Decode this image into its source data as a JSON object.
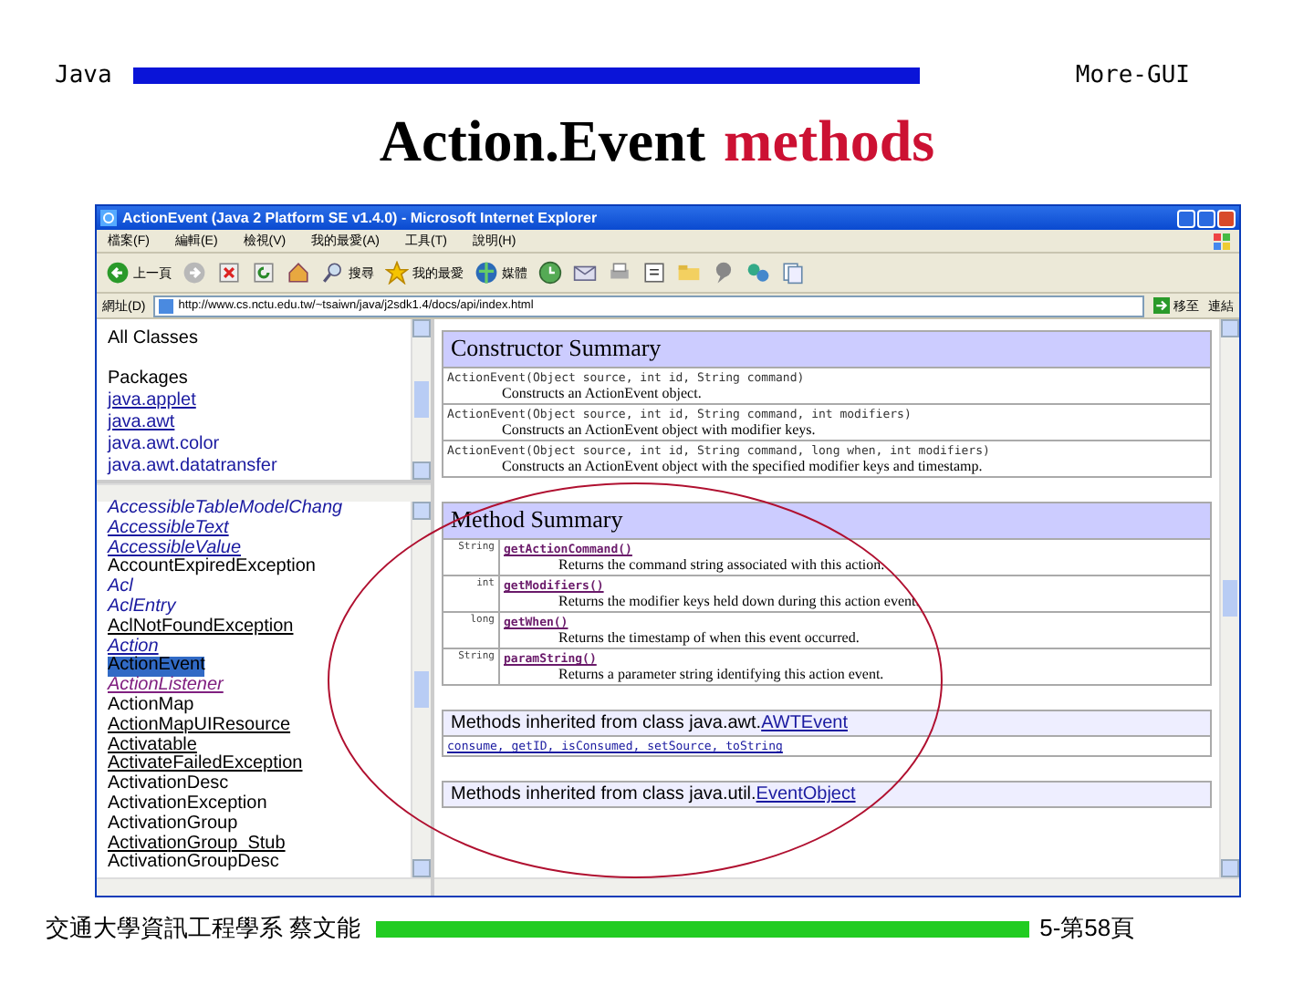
{
  "slide": {
    "header_left": "Java",
    "header_right": "More-GUI",
    "title_main": "Action.Event",
    "title_accent": "methods",
    "footer_left": "交通大學資訊工程學系 蔡文能",
    "footer_right": "5-第58頁"
  },
  "browser": {
    "title": "ActionEvent (Java 2 Platform SE v1.4.0) - Microsoft Internet Explorer",
    "menu": [
      "檔案(F)",
      "編輯(E)",
      "檢視(V)",
      "我的最愛(A)",
      "工具(T)",
      "說明(H)"
    ],
    "toolbar": [
      {
        "kind": "back",
        "label": "上一頁"
      },
      {
        "kind": "forward"
      },
      {
        "kind": "stop"
      },
      {
        "kind": "refresh"
      },
      {
        "kind": "home"
      },
      {
        "kind": "search",
        "label": "搜尋"
      },
      {
        "kind": "favorites",
        "label": "我的最愛"
      },
      {
        "kind": "media",
        "label": "媒體"
      },
      {
        "kind": "history"
      },
      {
        "kind": "mail"
      },
      {
        "kind": "print"
      },
      {
        "kind": "edit"
      },
      {
        "kind": "folder"
      },
      {
        "kind": "messenger"
      },
      {
        "kind": "network"
      },
      {
        "kind": "copy"
      }
    ],
    "address": {
      "label": "網址(D)",
      "value": "http://www.cs.nctu.edu.tw/~tsaiwn/java/j2sdk1.4/docs/api/index.html",
      "go_label": "移至",
      "links_label": "連結"
    },
    "all_classes": "All Classes",
    "packages_heading": "Packages",
    "packages": [
      {
        "text": "java.applet",
        "underlined": true
      },
      {
        "text": "java.awt",
        "underlined": true
      },
      {
        "text": "java.awt.color",
        "underlined": false
      },
      {
        "text": "java.awt.datatransfer",
        "underlined": false
      }
    ],
    "class_list": [
      {
        "text": "AccessibleTableModelChang",
        "kind": "interface",
        "underlined": false,
        "selected": false
      },
      {
        "text": "AccessibleText",
        "kind": "interface",
        "underlined": true,
        "selected": false
      },
      {
        "text": "AccessibleValue",
        "kind": "interface",
        "underlined": true,
        "selected": false
      },
      {
        "text": "AccountExpiredException",
        "kind": "class",
        "underlined": false,
        "selected": false
      },
      {
        "text": "Acl",
        "kind": "interface",
        "underlined": false,
        "selected": false
      },
      {
        "text": "AclEntry",
        "kind": "interface",
        "underlined": false,
        "selected": false
      },
      {
        "text": "AclNotFoundException",
        "kind": "class",
        "underlined": true,
        "selected": false
      },
      {
        "text": "Action",
        "kind": "interface",
        "underlined": true,
        "selected": false
      },
      {
        "text": "ActionEvent",
        "kind": "class",
        "underlined": false,
        "selected": true
      },
      {
        "text": "ActionListener",
        "kind": "visited-interface",
        "underlined": true,
        "selected": false
      },
      {
        "text": "ActionMap",
        "kind": "class",
        "underlined": false,
        "selected": false
      },
      {
        "text": "ActionMapUIResource",
        "kind": "class",
        "underlined": true,
        "selected": false
      },
      {
        "text": "Activatable",
        "kind": "class",
        "underlined": true,
        "selected": false
      },
      {
        "text": "ActivateFailedException",
        "kind": "class",
        "underlined": true,
        "selected": false
      },
      {
        "text": "ActivationDesc",
        "kind": "class",
        "underlined": false,
        "selected": false
      },
      {
        "text": "ActivationException",
        "kind": "class",
        "underlined": false,
        "selected": false
      },
      {
        "text": "ActivationGroup",
        "kind": "class",
        "underlined": false,
        "selected": false
      },
      {
        "text": "ActivationGroup_Stub",
        "kind": "class",
        "underlined": true,
        "selected": false
      },
      {
        "text": "ActivationGroupDesc",
        "kind": "class",
        "underlined": false,
        "selected": false
      }
    ],
    "constructor_summary": {
      "heading": "Constructor Summary",
      "rows": [
        {
          "signature": "ActionEvent(Object source, int id, String command)",
          "description": "Constructs an ActionEvent object."
        },
        {
          "signature": "ActionEvent(Object source, int id, String command, int modifiers)",
          "description": "Constructs an ActionEvent object with modifier keys."
        },
        {
          "signature": "ActionEvent(Object source, int id, String command, long when, int modifiers)",
          "description": "Constructs an ActionEvent object with the specified modifier keys and timestamp."
        }
      ]
    },
    "method_summary": {
      "heading": "Method Summary",
      "rows": [
        {
          "type": "String",
          "signature": "getActionCommand()",
          "description": "Returns the command string associated with this action."
        },
        {
          "type": "int",
          "signature": "getModifiers()",
          "description": "Returns the modifier keys held down during this action event."
        },
        {
          "type": "long",
          "signature": "getWhen()",
          "description": "Returns the timestamp of when this event occurred."
        },
        {
          "type": "String",
          "signature": "paramString()",
          "description": "Returns a parameter string identifying this action event."
        }
      ]
    },
    "inherited": [
      {
        "heading": "Methods inherited from class java.awt.",
        "link": "AWTEvent",
        "methods": "consume, getID, isConsumed, setSource, toString"
      },
      {
        "heading": "Methods inherited from class java.util.",
        "link": "EventObject"
      }
    ]
  }
}
